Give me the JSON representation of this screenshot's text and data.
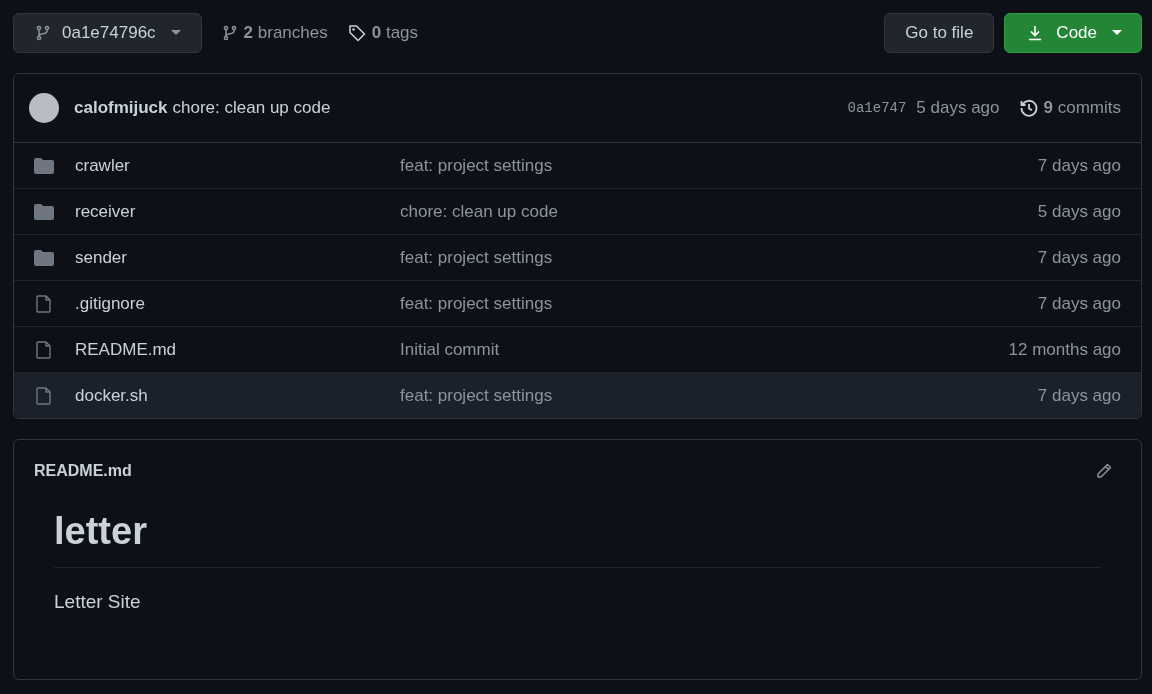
{
  "branch_button": {
    "label": "0a1e74796c"
  },
  "branches_link": {
    "text": "**2** branches"
  },
  "tags_link": {
    "text": "**0** tags"
  },
  "go_to_file_button": {
    "label": "Go to file"
  },
  "code_button": {
    "label": "Code"
  },
  "latest_commit": {
    "author": "calofmijuck",
    "message": "chore: clean up code",
    "hash": "0a1e747",
    "time": "5 days ago",
    "commits": "**9** commits"
  },
  "files": [
    {
      "kind": "folder",
      "name": "crawler",
      "message": "feat: project settings",
      "time": "7 days ago",
      "selected": false
    },
    {
      "kind": "folder",
      "name": "receiver",
      "message": "chore: clean up code",
      "time": "5 days ago",
      "selected": false
    },
    {
      "kind": "folder",
      "name": "sender",
      "message": "feat: project settings",
      "time": "7 days ago",
      "selected": false
    },
    {
      "kind": "file",
      "name": ".gitignore",
      "message": "feat: project settings",
      "time": "7 days ago",
      "selected": false
    },
    {
      "kind": "file",
      "name": "README.md",
      "message": "Initial commit",
      "time": "12 months ago",
      "selected": false
    },
    {
      "kind": "file",
      "name": "docker.sh",
      "message": "feat: project settings",
      "time": "7 days ago",
      "selected": true
    }
  ],
  "readme": {
    "filename": "README.md",
    "heading": "letter",
    "body": "Letter Site"
  }
}
